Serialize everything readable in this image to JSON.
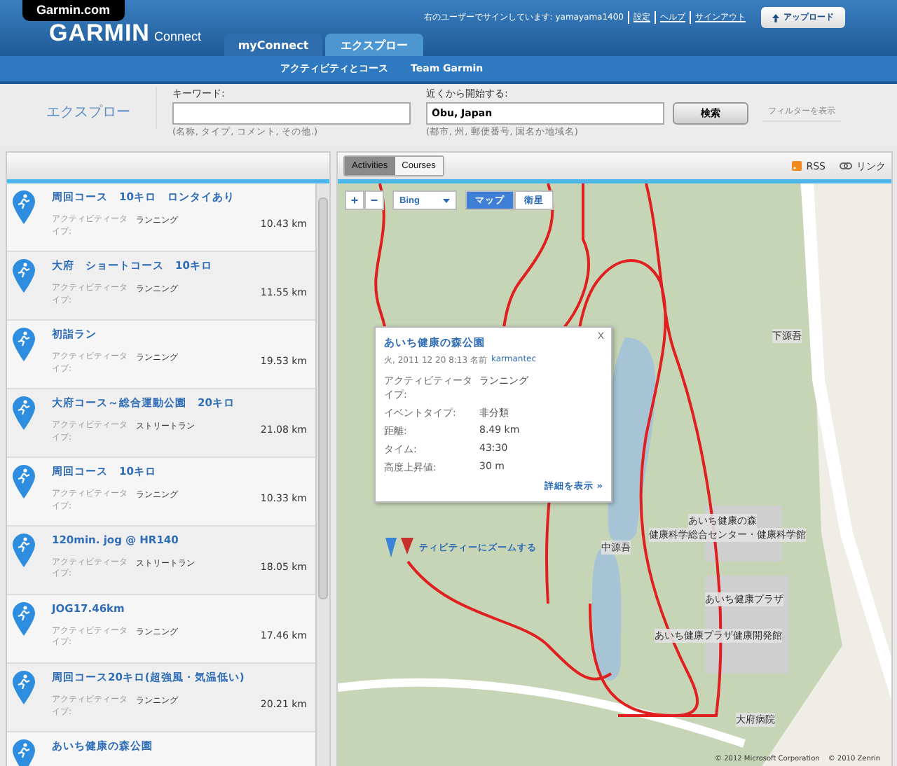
{
  "header": {
    "site_tab": "Garmin.com",
    "logo": "GARMIN",
    "logo_sub": "Connect",
    "signin_text": "右のユーザーでサインしています: yamayama1400",
    "links": [
      "設定",
      "ヘルプ",
      "サインアウト"
    ],
    "upload_button": "アップロード",
    "tabs": [
      {
        "label": "myConnect",
        "selected": false
      },
      {
        "label": "エクスプロー",
        "selected": true
      }
    ],
    "subnav": [
      "アクティビティとコース",
      "Team Garmin"
    ]
  },
  "search": {
    "title": "エクスプロー",
    "keyword": {
      "label": "キーワード:",
      "hint": "(名称, タイプ, コメント, その他.)"
    },
    "location": {
      "label": "近くから開始する:",
      "value": "Ōbu, Japan",
      "hint": "(都市, 州, 郵便番号, 国名か地域名)"
    },
    "button": "検索",
    "filter_toggle": "フィルターを表示"
  },
  "list": [
    {
      "title": "周回コース　10キロ　ロンタイあり",
      "type_label": "アクティビティータイプ:",
      "type": "ランニング",
      "distance": "10.43 km"
    },
    {
      "title": "大府　ショートコース　10キロ",
      "type_label": "アクティビティータイプ:",
      "type": "ランニング",
      "distance": "11.55 km"
    },
    {
      "title": "初詣ラン",
      "type_label": "アクティビティータイプ:",
      "type": "ランニング",
      "distance": "19.53 km"
    },
    {
      "title": "大府コース～総合運動公園　20キロ",
      "type_label": "アクティビティータイプ:",
      "type": "ストリートラン",
      "distance": "21.08 km"
    },
    {
      "title": "周回コース　10キロ",
      "type_label": "アクティビティータイプ:",
      "type": "ランニング",
      "distance": "10.33 km"
    },
    {
      "title": "120min. jog @ HR140",
      "type_label": "アクティビティータイプ:",
      "type": "ストリートラン",
      "distance": "18.05 km"
    },
    {
      "title": "JOG17.46km",
      "type_label": "アクティビティータイプ:",
      "type": "ランニング",
      "distance": "17.46 km"
    },
    {
      "title": "周回コース20キロ(超強風・気温低い)",
      "type_label": "アクティビティータイプ:",
      "type": "ランニング",
      "distance": "20.21 km"
    },
    {
      "title": "あいち健康の森公園"
    }
  ],
  "view_tabs": [
    {
      "label": "Activities",
      "selected": true
    },
    {
      "label": "Courses",
      "selected": false
    }
  ],
  "feed_links": [
    {
      "kind": "rss",
      "label": "RSS"
    },
    {
      "kind": "link",
      "label": "リンク"
    }
  ],
  "map": {
    "zoom_buttons": [
      "+",
      "−"
    ],
    "provider": "Bing",
    "map_types": [
      {
        "label": "マップ",
        "selected": true
      },
      {
        "label": "衛星",
        "selected": false
      }
    ],
    "labels": [
      "下源吾",
      "中源吾",
      "あいち健康の森",
      "健康科学総合センター・健康科学館",
      "あいち健康プラザ",
      "あいち健康プラザ健康開発館",
      "大府病院"
    ],
    "copyright": [
      "© 2012 Microsoft Corporation",
      "© 2010 Zenrin"
    ],
    "zoom_link": "ティビティーにズームする",
    "popup": {
      "title": "あいち健康の森公園",
      "meta": "火, 2011 12 20 8:13 名前",
      "author": "karmantec",
      "close": "X",
      "fields": [
        {
          "label": "アクティビティータイプ:",
          "value": "ランニング"
        },
        {
          "label": "イベントタイプ:",
          "value": "非分類"
        },
        {
          "label": "距離:",
          "value": "8.49 km"
        },
        {
          "label": "タイム:",
          "value": "43:30"
        },
        {
          "label": "高度上昇値:",
          "value": "30 m"
        }
      ],
      "details_link": "詳細を表示 »"
    }
  }
}
